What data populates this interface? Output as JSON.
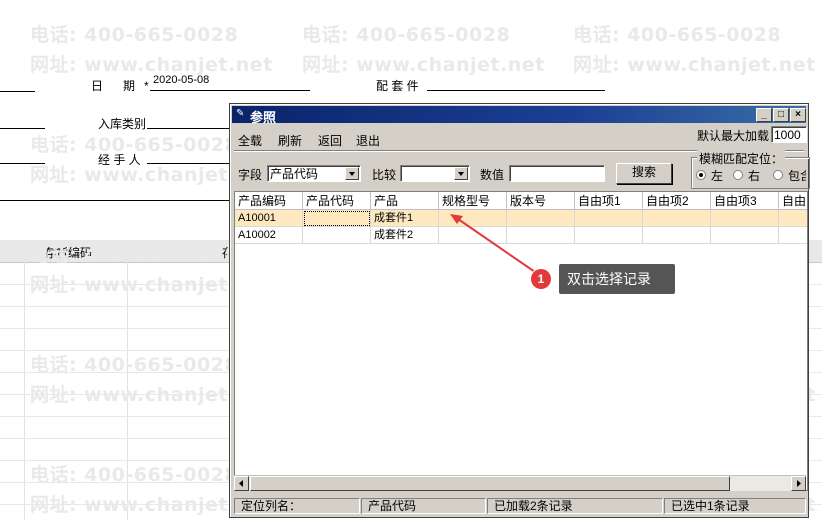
{
  "watermark": {
    "phone": "电话: 400-665-0028",
    "site": "网址: www.chanjet.net"
  },
  "form": {
    "date_label": "日　期",
    "required_mark": "*",
    "date_value": "2020-05-08",
    "component_label": "配 套 件",
    "inbound_type_label": "入库类别",
    "handler_label": "经 手 人",
    "grid_header_code": "存货编码",
    "grid_header_other": "存"
  },
  "dialog": {
    "title": "参照",
    "title_icon": "pin-icon",
    "controls": [
      "_",
      "□",
      "×"
    ],
    "menu": [
      "全载",
      "刷新",
      "返回",
      "退出"
    ],
    "max_load_label": "默认最大加载",
    "max_load_value": "1000",
    "search": {
      "field_label": "字段",
      "field_value": "产品代码",
      "compare_label": "比较",
      "compare_value": "",
      "value_label": "数值",
      "value_value": "",
      "search_button": "搜索"
    },
    "fuzzy": {
      "group_label": "模糊匹配定位：",
      "options": [
        "左",
        "右",
        "包含"
      ],
      "selected": "左"
    },
    "columns": [
      "产品编码",
      "产品代码",
      "产品",
      "规格型号",
      "版本号",
      "自由项1",
      "自由项2",
      "自由项3",
      "自由"
    ],
    "rows": [
      [
        "A10001",
        "",
        "成套件1",
        "",
        "",
        "",
        "",
        "",
        ""
      ],
      [
        "A10002",
        "",
        "成套件2",
        "",
        "",
        "",
        "",
        "",
        ""
      ]
    ],
    "selected_row": 0,
    "status": {
      "locate_col_label": "定位列名：",
      "locate_col_value": "产品代码",
      "loaded": "已加载2条记录",
      "selected": "已选中1条记录"
    }
  },
  "annotation": {
    "number": "1",
    "text": "双击选择记录",
    "color": "#e03a3a"
  }
}
